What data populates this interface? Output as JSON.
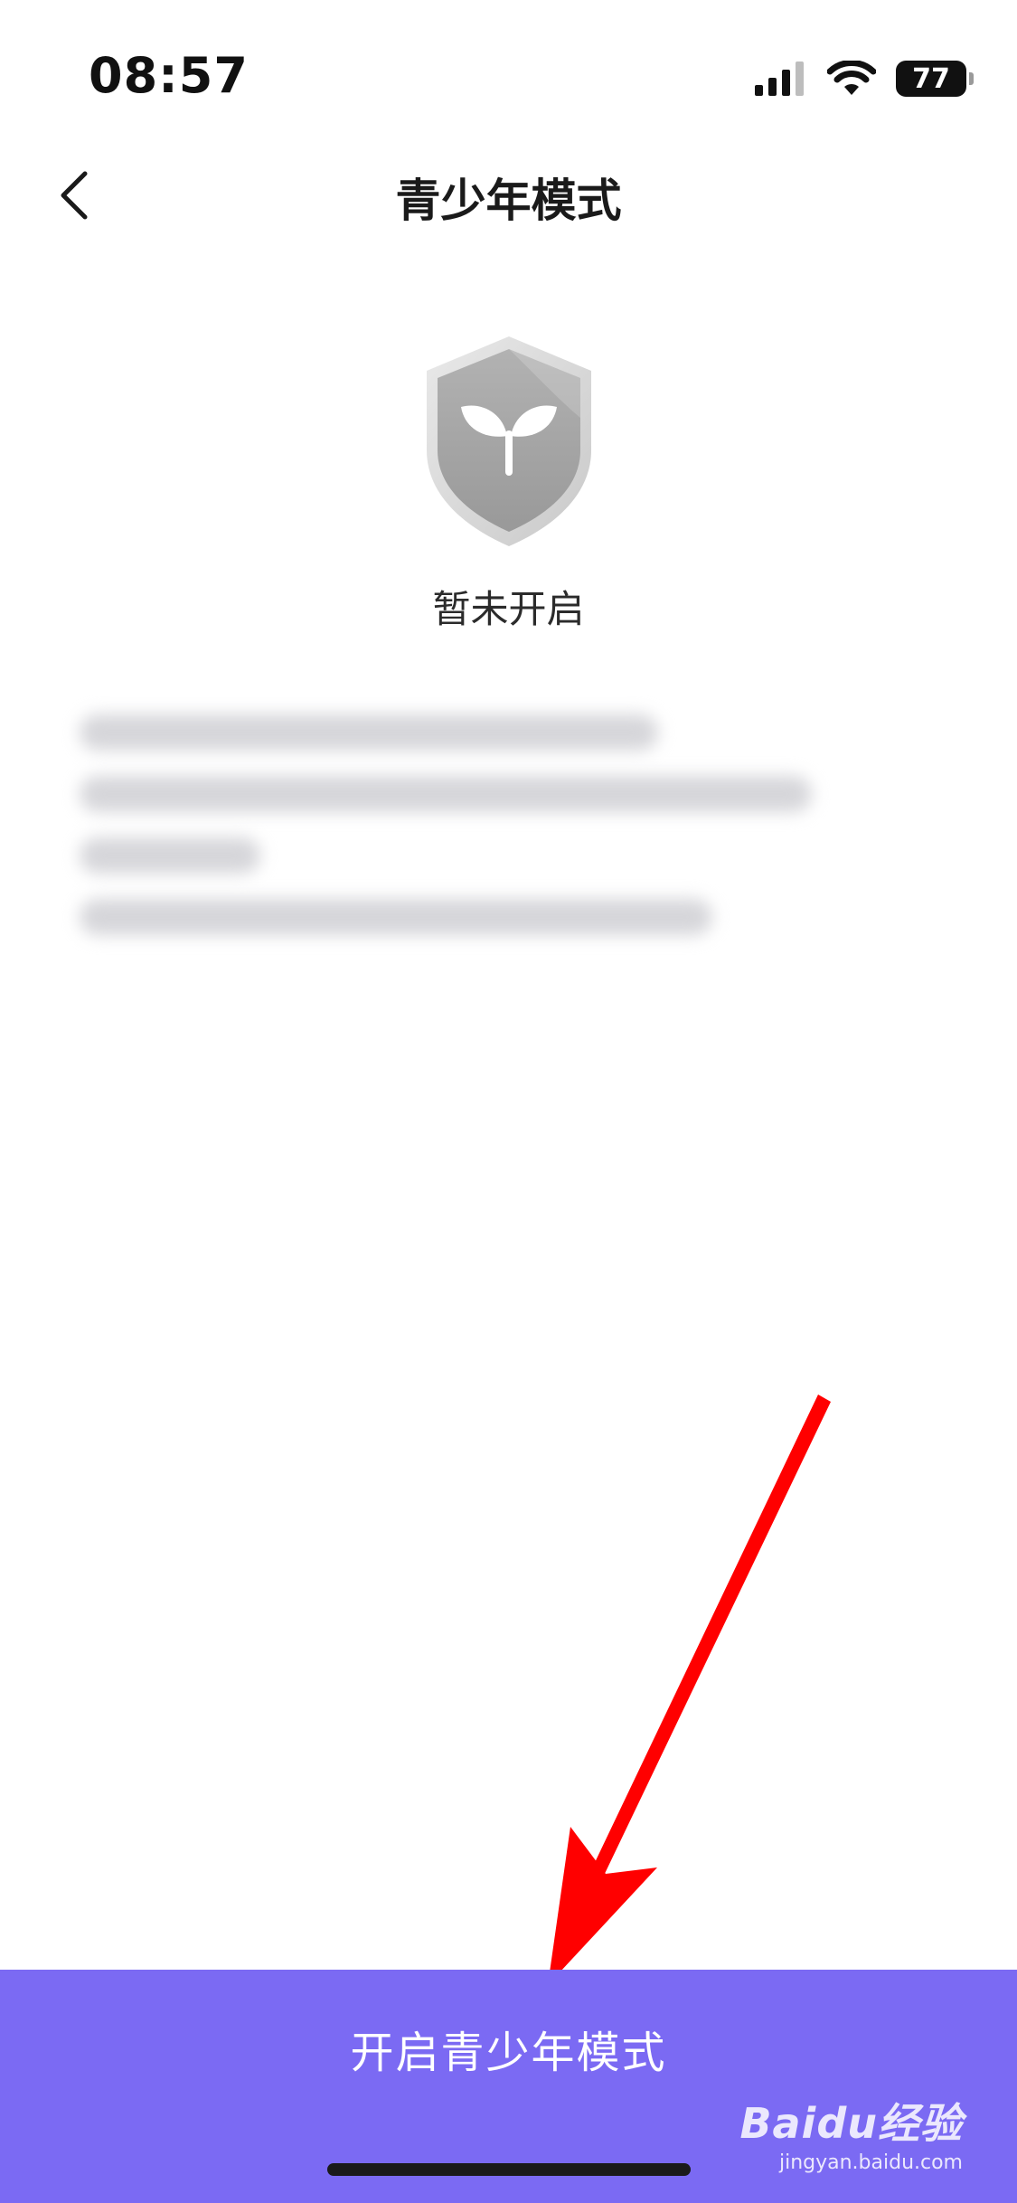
{
  "status_bar": {
    "time": "08:57",
    "battery": "77",
    "icons": [
      "cellular-signal-icon",
      "wifi-icon",
      "battery-icon"
    ]
  },
  "nav": {
    "back_icon": "chevron-left-icon",
    "title": "青少年模式"
  },
  "mode": {
    "icon": "shield-sprout-icon",
    "status": "暂未开启"
  },
  "description_blurred": true,
  "annotation": {
    "icon": "red-arrow-icon",
    "color": "#ff0000"
  },
  "action": {
    "enable_label": "开启青少年模式",
    "color": "#7b6af3"
  },
  "watermark": {
    "brand": "Baidu经验",
    "domain": "jingyan.baidu.com"
  }
}
